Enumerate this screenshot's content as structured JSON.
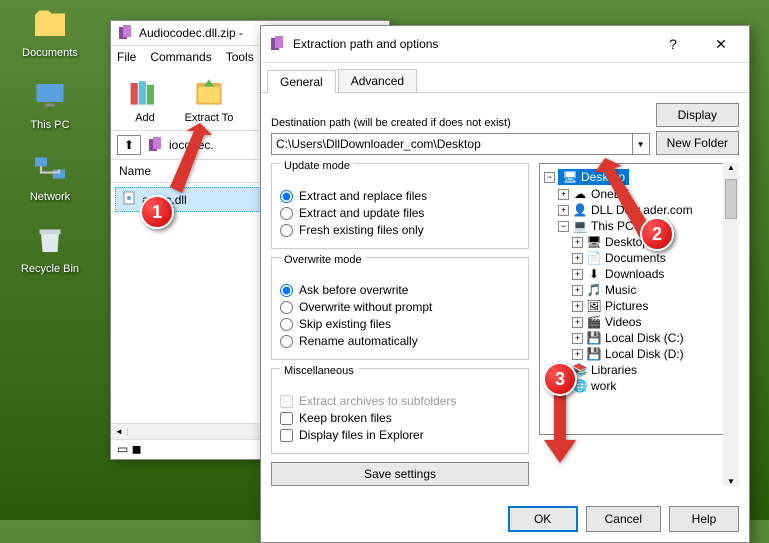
{
  "desktop": {
    "icons": [
      {
        "label": "Documents"
      },
      {
        "label": "This PC"
      },
      {
        "label": "Network"
      },
      {
        "label": "Recycle Bin"
      }
    ]
  },
  "winrar": {
    "title": "Audiocodec.dll.zip -",
    "menu": {
      "file": "File",
      "commands": "Commands",
      "tools": "Tools"
    },
    "toolbar": {
      "add": "Add",
      "extract_to": "Extract To"
    },
    "path_file": "iocodec.",
    "col_name": "Name",
    "selected_file": "a           dec.dll"
  },
  "dialog": {
    "title": "Extraction path and options",
    "help_icon": "?",
    "close_icon": "✕",
    "tabs": {
      "general": "General",
      "advanced": "Advanced"
    },
    "dest_label": "Destination path (will be created if does not exist)",
    "dest_value": "C:\\Users\\DllDownloader_com\\Desktop",
    "display_btn": "Display",
    "newfolder_btn": "New Folder",
    "update_mode": {
      "legend": "Update mode",
      "opt1": "Extract and replace files",
      "opt2": "Extract and update files",
      "opt3": "Fresh existing files only"
    },
    "overwrite_mode": {
      "legend": "Overwrite mode",
      "opt1": "Ask before overwrite",
      "opt2": "Overwrite without prompt",
      "opt3": "Skip existing files",
      "opt4": "Rename automatically"
    },
    "misc": {
      "legend": "Miscellaneous",
      "opt1": "Extract archives to subfolders",
      "opt2": "Keep broken files",
      "opt3": "Display files in Explorer"
    },
    "save_btn": "Save settings",
    "tree": {
      "desktop": "Desktop",
      "onedrive": "OneDri",
      "dlldown": "DLL Dow     ader.com",
      "thispc": "This PC",
      "sub_desktop": "Desktop",
      "documents": "Documents",
      "downloads": "Downloads",
      "music": "Music",
      "pictures": "Pictures",
      "videos": "Videos",
      "localc": "Local Disk (C:)",
      "locald": "Local Disk (D:)",
      "libraries": "Libraries",
      "network": "work"
    },
    "buttons": {
      "ok": "OK",
      "cancel": "Cancel",
      "help": "Help"
    }
  },
  "badges": {
    "b1": "1",
    "b2": "2",
    "b3": "3"
  }
}
